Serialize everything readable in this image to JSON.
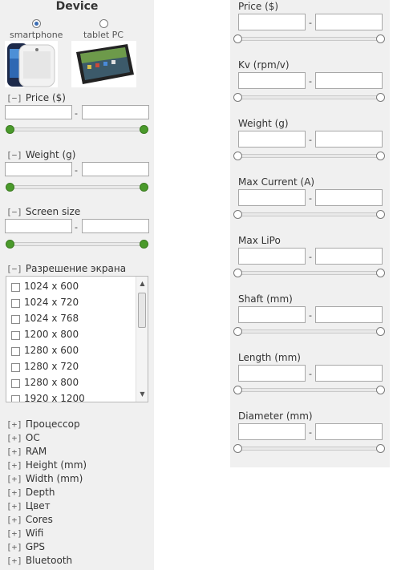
{
  "device": {
    "title": "Device",
    "options": [
      {
        "label": "smartphone",
        "selected": true
      },
      {
        "label": "tablet PC",
        "selected": false
      }
    ]
  },
  "left_filters": [
    {
      "toggle": "[−]",
      "label": "Price ($)",
      "dash": "-"
    },
    {
      "toggle": "[−]",
      "label": "Weight (g)",
      "dash": "-"
    },
    {
      "toggle": "[−]",
      "label": "Screen size",
      "dash": "-"
    }
  ],
  "resolution": {
    "toggle": "[−]",
    "label": "Разрешение экрана",
    "items": [
      "1024 x 600",
      "1024 x 720",
      "1024 x 768",
      "1200 x 800",
      "1280 x 600",
      "1280 x 720",
      "1280 x 800",
      "1920 x 1200"
    ]
  },
  "collapsed_sections": {
    "toggle": "[+]",
    "labels": [
      "Процессор",
      "ОС",
      "RAM",
      "Height (mm)",
      "Width (mm)",
      "Depth",
      "Цвет",
      "Cores",
      "Wifi",
      "GPS",
      "Bluetooth"
    ]
  },
  "right_filters": [
    {
      "label": "Price ($)",
      "dash": "-"
    },
    {
      "label": "Kv (rpm/v)",
      "dash": "-"
    },
    {
      "label": "Weight (g)",
      "dash": "-"
    },
    {
      "label": "Max Current (A)",
      "dash": "-"
    },
    {
      "label": "Max LiPo",
      "dash": "-"
    },
    {
      "label": "Shaft (mm)",
      "dash": "-"
    },
    {
      "label": "Length (mm)",
      "dash": "-"
    },
    {
      "label": "Diameter (mm)",
      "dash": "-"
    }
  ],
  "colors": {
    "slider_active": "#4a9a2b",
    "radio_selected": "#3b6db3"
  }
}
